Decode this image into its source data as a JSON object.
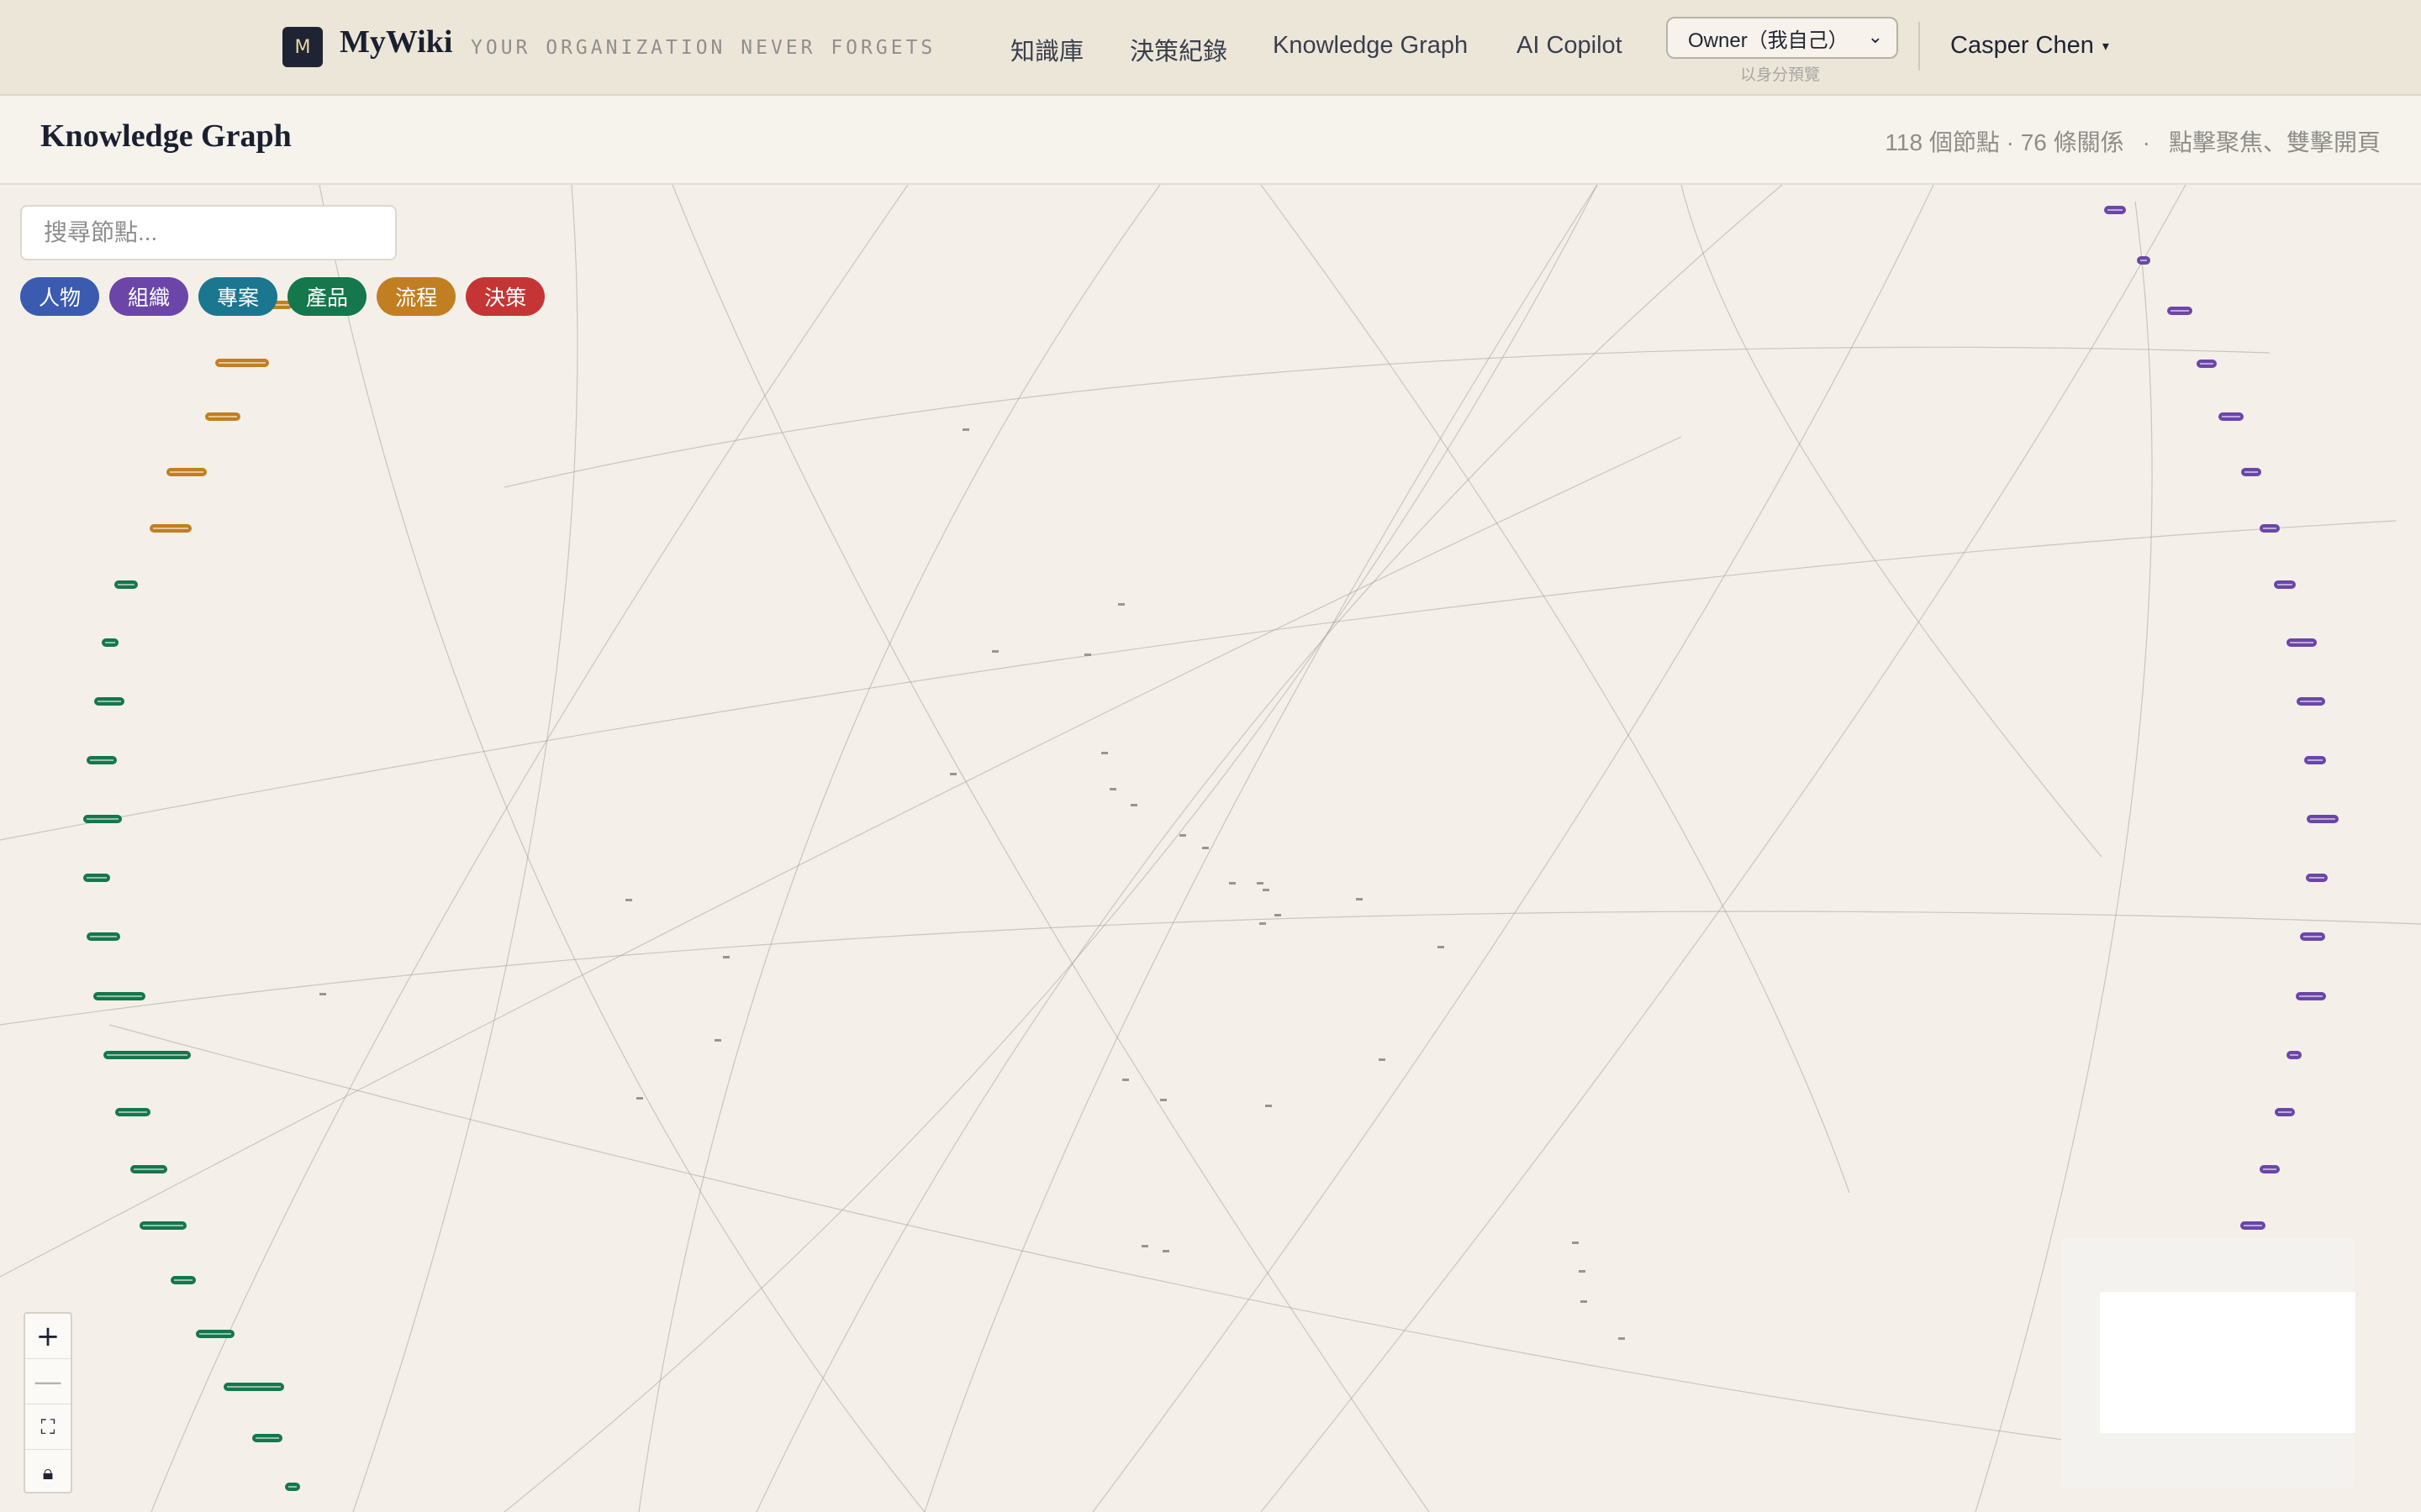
{
  "header": {
    "logo_letter": "M",
    "brand": "MyWiki",
    "tagline": "YOUR ORGANIZATION NEVER FORGETS",
    "nav": [
      "知識庫",
      "決策紀錄",
      "Knowledge Graph",
      "AI Copilot"
    ],
    "role_select": "Owner（我自己）",
    "role_hint": "以身分預覽",
    "user": "Casper Chen"
  },
  "page": {
    "title": "Knowledge Graph",
    "stats": "118 個節點 · 76 條關係",
    "hint": "點擊聚焦、雙擊開頁"
  },
  "search": {
    "placeholder": "搜尋節點..."
  },
  "filters": [
    {
      "label": "人物",
      "color": "#3a5bb0"
    },
    {
      "label": "組織",
      "color": "#6b46a8"
    },
    {
      "label": "專案",
      "color": "#1b7690"
    },
    {
      "label": "產品",
      "color": "#15774c"
    },
    {
      "label": "流程",
      "color": "#c17f22"
    },
    {
      "label": "決策",
      "color": "#c53535"
    }
  ],
  "zoom_controls": [
    "zoom-in",
    "zoom-out",
    "fit-view",
    "lock"
  ],
  "graph": {
    "colors": {
      "org": "#6b46a8",
      "product": "#15774c",
      "process": "#c17f22",
      "edge": "#a8a39a"
    }
  }
}
